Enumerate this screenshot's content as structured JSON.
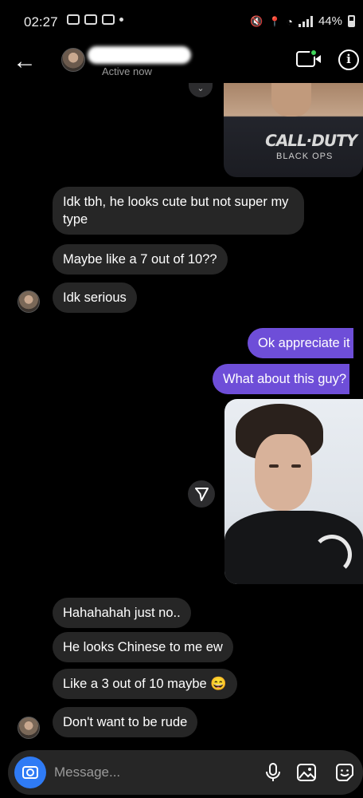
{
  "status_bar": {
    "time": "02:27",
    "battery": "44%"
  },
  "header": {
    "active_status": "Active now"
  },
  "messages": [
    {
      "side": "received",
      "text": "Idk tbh, he looks cute but not super"
    },
    {
      "side": "received",
      "text": "my type"
    },
    {
      "side": "received",
      "text": "Maybe like a 7 out of 10??"
    },
    {
      "side": "received",
      "text": "Idk serious"
    },
    {
      "side": "sent",
      "text": "Ok appreciate it"
    },
    {
      "side": "sent",
      "text": "What about this guy?"
    },
    {
      "side": "received",
      "text": "Hahahahah just no.."
    },
    {
      "side": "received",
      "text": "He looks Chinese to me ew"
    },
    {
      "side": "received",
      "text": "Like a 3 out of 10 maybe 😄"
    },
    {
      "side": "received",
      "text": "Don't want to be rude"
    }
  ],
  "shared_images": [
    {
      "shirt_text_1": "CALL·DUTY",
      "shirt_text_2": "BLACK OPS"
    }
  ],
  "composer": {
    "placeholder": "Message..."
  },
  "colors": {
    "sent_bubble": "#6e4ed8",
    "received_bubble": "#262626",
    "camera_button": "#2f7bf5",
    "online_dot": "#3fd55a"
  }
}
